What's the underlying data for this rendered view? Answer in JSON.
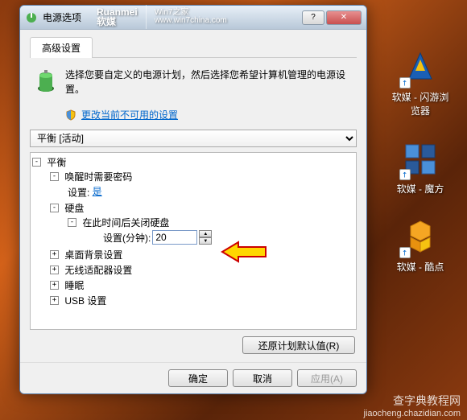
{
  "watermark": {
    "brand1": "Ruanmei",
    "brand1_sub": "软媒",
    "brand2": "Win7之家",
    "brand2_sub": "www.win7china.com",
    "bottom1": "查字典教程网",
    "bottom2": "jiaocheng.chazidian.com"
  },
  "desktop": [
    {
      "label": "软媒 - 闪游浏览器",
      "color": "#1a5fb4"
    },
    {
      "label": "软媒 - 魔方",
      "color": "#4a90d9"
    },
    {
      "label": "软媒 - 酷点",
      "color": "#f5a623"
    }
  ],
  "dialog": {
    "title": "电源选项",
    "tab": "高级设置",
    "info": "选择您要自定义的电源计划，然后选择您希望计算机管理的电源设置。",
    "link": "更改当前不可用的设置",
    "plan": "平衡 [活动]",
    "tree": {
      "root": "平衡",
      "wake": "唤醒时需要密码",
      "wake_setting_label": "设置: ",
      "wake_setting_value": "是",
      "disk": "硬盘",
      "disk_off": "在此时间后关闭硬盘",
      "disk_setting_label": "设置(分钟):",
      "disk_setting_value": "20",
      "desktop_bg": "桌面背景设置",
      "wireless": "无线适配器设置",
      "sleep": "睡眠",
      "usb": "USB 设置"
    },
    "restore": "还原计划默认值(R)",
    "ok": "确定",
    "cancel": "取消",
    "apply": "应用(A)"
  }
}
